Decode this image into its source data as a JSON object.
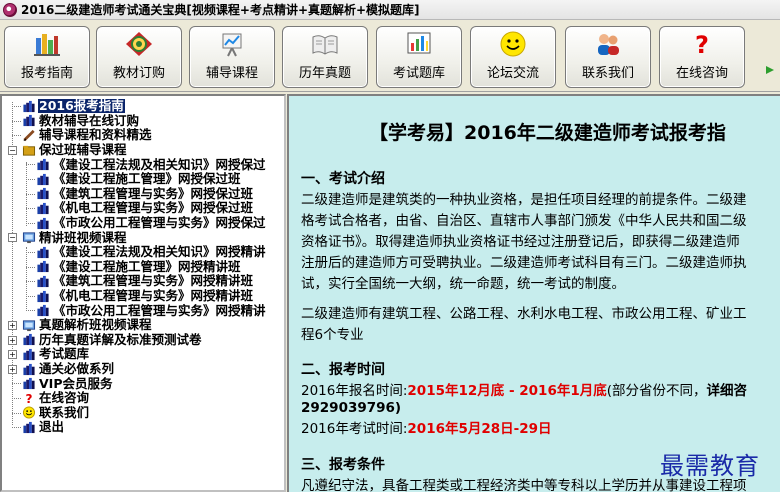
{
  "window": {
    "title": "2016二级建造师考试通关宝典[视频课程+考点精讲+真题解析+模拟题库]"
  },
  "toolbar": {
    "buttons": [
      {
        "label": "报考指南",
        "icon": "books-icon"
      },
      {
        "label": "教材订购",
        "icon": "globe-badge-icon"
      },
      {
        "label": "辅导课程",
        "icon": "chart-board-icon"
      },
      {
        "label": "历年真题",
        "icon": "open-book-icon"
      },
      {
        "label": "考试题库",
        "icon": "exam-chart-icon"
      },
      {
        "label": "论坛交流",
        "icon": "smiley-icon"
      },
      {
        "label": "联系我们",
        "icon": "users-icon"
      },
      {
        "label": "在线咨询",
        "icon": "question-icon"
      }
    ]
  },
  "tree": {
    "items": [
      {
        "label": "2016报考指南",
        "level": 0,
        "icon": "books-icon",
        "selected": true
      },
      {
        "label": "教材辅导在线订购",
        "level": 0,
        "icon": "books-icon"
      },
      {
        "label": "辅导课程和资料精选",
        "level": 0,
        "icon": "pen-icon"
      },
      {
        "label": "保过班辅导课程",
        "level": 0,
        "icon": "folder-icon",
        "expander": "−"
      },
      {
        "label": "《建设工程法规及相关知识》网授保过",
        "level": 1,
        "icon": "books-icon"
      },
      {
        "label": "《建设工程施工管理》网授保过班",
        "level": 1,
        "icon": "books-icon"
      },
      {
        "label": "《建筑工程管理与实务》网授保过班",
        "level": 1,
        "icon": "books-icon"
      },
      {
        "label": "《机电工程管理与实务》网授保过班",
        "level": 1,
        "icon": "books-icon"
      },
      {
        "label": "《市政公用工程管理与实务》网授保过",
        "level": 1,
        "icon": "books-icon"
      },
      {
        "label": "精讲班视频课程",
        "level": 0,
        "icon": "video-icon",
        "expander": "−"
      },
      {
        "label": "《建设工程法规及相关知识》网授精讲",
        "level": 1,
        "icon": "books-icon"
      },
      {
        "label": "《建设工程施工管理》网授精讲班",
        "level": 1,
        "icon": "books-icon"
      },
      {
        "label": "《建筑工程管理与实务》网授精讲班",
        "level": 1,
        "icon": "books-icon"
      },
      {
        "label": "《机电工程管理与实务》网授精讲班",
        "level": 1,
        "icon": "books-icon"
      },
      {
        "label": "《市政公用工程管理与实务》网授精讲",
        "level": 1,
        "icon": "books-icon"
      },
      {
        "label": "真题解析班视频课程",
        "level": 0,
        "icon": "video-icon",
        "expander": "+"
      },
      {
        "label": "历年真题详解及标准预测试卷",
        "level": 0,
        "icon": "books-icon",
        "expander": "+"
      },
      {
        "label": "考试题库",
        "level": 0,
        "icon": "books-icon",
        "expander": "+"
      },
      {
        "label": "通关必做系列",
        "level": 0,
        "icon": "books-icon",
        "expander": "+"
      },
      {
        "label": "VIP会员服务",
        "level": 0,
        "icon": "books-icon"
      },
      {
        "label": "在线咨询",
        "level": 0,
        "icon": "question-icon"
      },
      {
        "label": "联系我们",
        "level": 0,
        "icon": "smiley-icon"
      },
      {
        "label": "退出",
        "level": 0,
        "icon": "books-icon"
      }
    ]
  },
  "content": {
    "title": "【学考易】2016年二级建造师考试报考指",
    "sections": {
      "intro_head": "一、考试介绍",
      "intro_lines": [
        "二级建造师是建筑类的一种执业资格，是担任项目经理的前提条件。二级建",
        "格考试合格者，由省、自治区、直辖市人事部门颁发《中华人民共和国二级",
        "资格证书》。取得建造师执业资格证书经过注册登记后，即获得二级建造师",
        "注册后的建造师方可受聘执业。二级建造师考试科目有三门。二级建造师执",
        "试，实行全国统一大纲，统一命题，统一考试的制度。"
      ],
      "intro_extra_1": "二级建造师有建筑工程、公路工程、水利水电工程、市政公用工程、矿业工",
      "intro_extra_2": "程6个专业",
      "time_head": "二、报考时间",
      "time_line1_prefix": "2016年报名时间:",
      "time_line1_red": "2015年12月底 - 2016年1月底",
      "time_line1_suffix": "(部分省份不同，",
      "time_line1_bold": "详细咨",
      "time_line2": "2929039796)",
      "time_line3_prefix": "2016年考试时间:",
      "time_line3_red": "2016年5月28日-29日",
      "cond_head": "三、报考条件",
      "cond_line": "凡遵纪守法，具备工程类或工程经济类中等专科以上学历并从事建设工程项"
    }
  },
  "watermark": {
    "text": "最需教育"
  },
  "colors": {
    "content_bg": "#c7eded",
    "highlight_red": "#e00000",
    "selected_bg": "#0a246a",
    "watermark": "#1a2aa8"
  }
}
